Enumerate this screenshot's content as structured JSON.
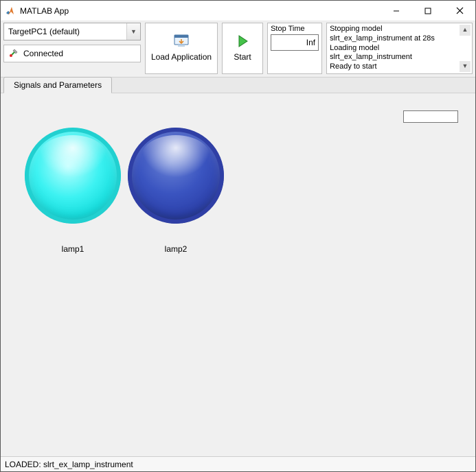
{
  "window": {
    "title": "MATLAB App"
  },
  "target_dropdown": {
    "selected": "TargetPC1 (default)"
  },
  "connect": {
    "label": "Connected"
  },
  "buttons": {
    "load_app": "Load Application",
    "start": "Start"
  },
  "stop_time": {
    "label": "Stop Time",
    "value": "Inf"
  },
  "log": {
    "lines": "Stopping model\nslrt_ex_lamp_instrument at 28s\nLoading model\nslrt_ex_lamp_instrument\nReady to start"
  },
  "tabs": {
    "active": "Signals and Parameters"
  },
  "lamps": {
    "lamp1": {
      "label": "lamp1",
      "color": "#2be8e8"
    },
    "lamp2": {
      "label": "lamp2",
      "color": "#2f44b0"
    }
  },
  "statusbar": {
    "text": "LOADED: slrt_ex_lamp_instrument"
  }
}
